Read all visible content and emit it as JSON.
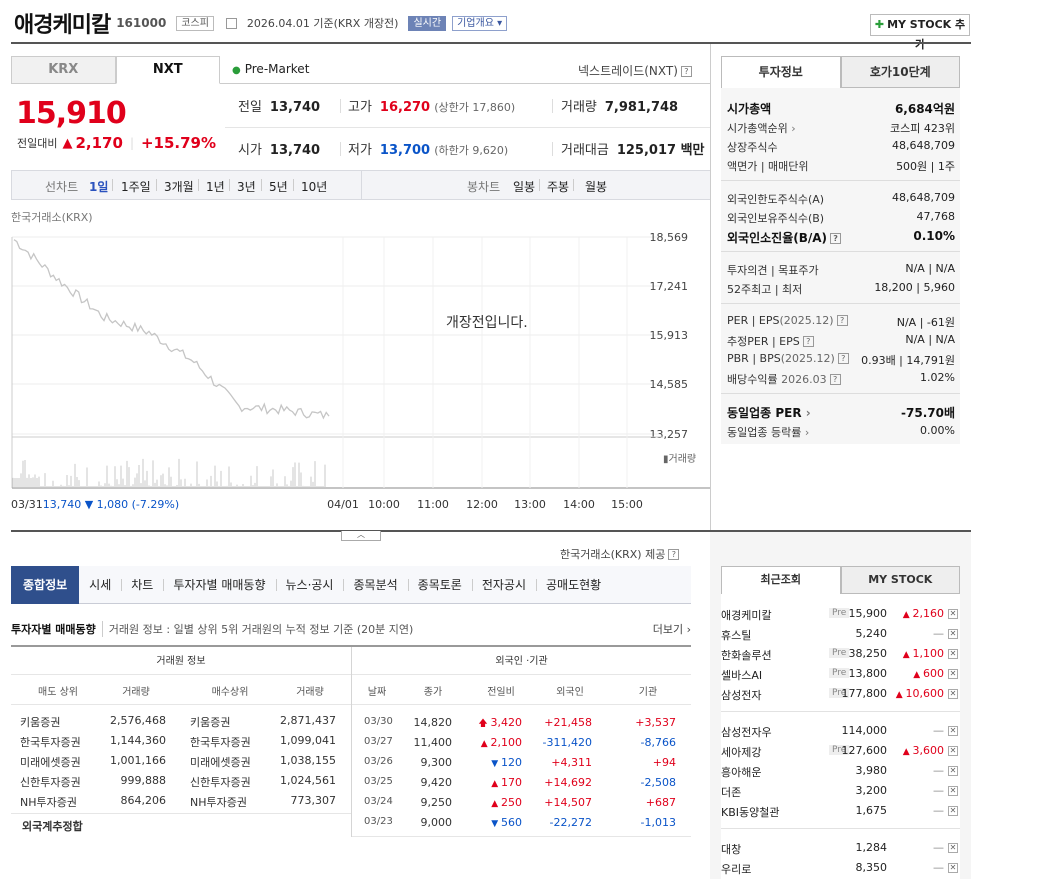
{
  "header": {
    "company_name": "애경케미칼",
    "code": "161000",
    "market_tag": "코스피",
    "date_text": "2026.04.01  기준(KRX 개장전)",
    "realtime_tag": "실시간",
    "company_overview": "기업개요",
    "mystock_button": "MY STOCK 추가"
  },
  "market_tabs": {
    "krx": "KRX",
    "nxt": "NXT"
  },
  "premarket_label": "Pre-Market",
  "nxt_link": "넥스트레이드(NXT)",
  "quote": {
    "price": "15,910",
    "change_label": "전일대비",
    "change_amount": "2,170",
    "change_percent": "+15.79%",
    "prev_close_label": "전일",
    "prev_close": "13,740",
    "high_label": "고가",
    "high": "16,270",
    "upper_limit": "(상한가 17,860)",
    "volume_label": "거래량",
    "volume": "7,981,748",
    "open_label": "시가",
    "open": "13,740",
    "low_label": "저가",
    "low": "13,700",
    "lower_limit": "(하한가 9,620)",
    "value_label": "거래대금",
    "value": "125,017 백만"
  },
  "period_bar": {
    "line_label": "선차트",
    "periods": [
      "1일",
      "1주일",
      "3개월",
      "1년",
      "3년",
      "5년",
      "10년"
    ],
    "candle_label": "봉차트",
    "candles": [
      "일봉",
      "주봉",
      "월봉"
    ]
  },
  "chart": {
    "source": "한국거래소(KRX)",
    "y_ticks": [
      "18,569",
      "17,241",
      "15,913",
      "14,585",
      "13,257"
    ],
    "volume_label": "거래량",
    "x_ticks": [
      "04/01",
      "10:00",
      "11:00",
      "12:00",
      "13:00",
      "14:00",
      "15:00"
    ],
    "prev_info_date": "03/31",
    "prev_info_price": "13,740",
    "prev_info_change": "1,080 (-7.29%)",
    "pre_open_message": "개장전입니다."
  },
  "chart_data": {
    "type": "line",
    "title": "",
    "x": [
      "03/31 09:00",
      "03/31 10:00",
      "03/31 11:00",
      "03/31 12:00",
      "03/31 13:00",
      "03/31 14:00",
      "03/31 15:00",
      "03/31 15:30"
    ],
    "series": [
      {
        "values": [
          18500,
          17400,
          16400,
          16000,
          15200,
          14000,
          13900,
          13740
        ]
      }
    ],
    "ylim": [
      13257,
      18569
    ],
    "xlabel": "",
    "ylabel": ""
  },
  "invest_tabs": {
    "info": "투자정보",
    "orderbook": "호가10단계"
  },
  "invest_info": {
    "market_cap_label": "시가총액",
    "market_cap": "6,684억원",
    "rank_label": "시가총액순위",
    "rank": "코스피  423위",
    "shares_label": "상장주식수",
    "shares": "48,648,709",
    "par_label": "액면가 | 매매단위",
    "par": "500원 | 1주",
    "foreign_limit_label": "외국인한도주식수(A)",
    "foreign_limit": "48,648,709",
    "foreign_hold_label": "외국인보유주식수(B)",
    "foreign_hold": "47,768",
    "foreign_ratio_label": "외국인소진율(B/A)",
    "foreign_ratio": "0.10%",
    "opinion_label": "투자의견 | 목표주가",
    "opinion": "N/A | N/A",
    "range52_label": "52주최고 | 최저",
    "range52": "18,200 | 5,960",
    "per_label": "PER | EPS",
    "per_sub": "(2025.12)",
    "per": "N/A | -61원",
    "est_label": "추정PER | EPS",
    "est": "N/A | N/A",
    "pbr_label": "PBR | BPS",
    "pbr_sub": "(2025.12)",
    "pbr": "0.93배 | 14,791원",
    "div_label": "배당수익률",
    "div_sub": "2026.03",
    "div": "1.02%",
    "sector_per_label": "동일업종 PER",
    "sector_per": "-75.70배",
    "sector_rate_label": "동일업종 등락률",
    "sector_rate": "0.00%"
  },
  "provider": "한국거래소(KRX) 제공",
  "main_tabs": [
    "종합정보",
    "시세",
    "차트",
    "투자자별 매매동향",
    "뉴스·공시",
    "종목분석",
    "종목토론",
    "전자공시",
    "공매도현황"
  ],
  "trade": {
    "title": "투자자별 매매동향",
    "desc": "거래원 정보 : 일별 상위 5위 거래원의 누적 정보 기준 (20분 지연)",
    "more": "더보기",
    "group_broker": "거래원 정보",
    "group_foreign": "외국인 ·기관",
    "broker_headers": [
      "매도 상위",
      "거래량",
      "매수상위",
      "거래량"
    ],
    "brokers": [
      [
        "키움증권",
        "2,576,468",
        "키움증권",
        "2,871,437"
      ],
      [
        "한국투자증권",
        "1,144,360",
        "한국투자증권",
        "1,099,041"
      ],
      [
        "미래에셋증권",
        "1,001,166",
        "미래에셋증권",
        "1,038,155"
      ],
      [
        "신한투자증권",
        "999,888",
        "신한투자증권",
        "1,024,561"
      ],
      [
        "NH투자증권",
        "864,206",
        "NH투자증권",
        "773,307"
      ]
    ],
    "foreign_total_label": "외국계추정합",
    "foreign_headers": [
      "날짜",
      "종가",
      "전일비",
      "외국인",
      "기관"
    ],
    "foreign_rows": [
      [
        "03/30",
        "14,820",
        "3,420",
        "+21,458",
        "+3,537"
      ],
      [
        "03/27",
        "11,400",
        "2,100",
        "-311,420",
        "-8,766"
      ],
      [
        "03/26",
        "9,300",
        "120",
        "+4,311",
        "+94"
      ],
      [
        "03/25",
        "9,420",
        "170",
        "+14,692",
        "-2,508"
      ],
      [
        "03/24",
        "9,250",
        "250",
        "+14,507",
        "+687"
      ],
      [
        "03/23",
        "9,000",
        "560",
        "-22,272",
        "-1,013"
      ]
    ]
  },
  "recent_tabs": {
    "recent": "최근조회",
    "mystock": "MY STOCK"
  },
  "recent": [
    {
      "name": "애경케미칼",
      "pre": "Pre",
      "price": "15,900",
      "change": "2,160",
      "dir": "up"
    },
    {
      "name": "휴스틸",
      "pre": "",
      "price": "5,240",
      "change": "",
      "dir": "flat"
    },
    {
      "name": "한화솔루션",
      "pre": "Pre",
      "price": "38,250",
      "change": "1,100",
      "dir": "up"
    },
    {
      "name": "셀바스AI",
      "pre": "Pre",
      "price": "13,800",
      "change": "600",
      "dir": "up"
    },
    {
      "name": "삼성전자",
      "pre": "Pre",
      "price": "177,800",
      "change": "10,600",
      "dir": "up"
    },
    {
      "name": "삼성전자우",
      "pre": "",
      "price": "114,000",
      "change": "",
      "dir": "flat"
    },
    {
      "name": "세아제강",
      "pre": "Pre",
      "price": "127,600",
      "change": "3,600",
      "dir": "up"
    },
    {
      "name": "흥아해운",
      "pre": "",
      "price": "3,980",
      "change": "",
      "dir": "flat"
    },
    {
      "name": "더존",
      "pre": "",
      "price": "3,200",
      "change": "",
      "dir": "flat"
    },
    {
      "name": "KBI동양철관",
      "pre": "",
      "price": "1,675",
      "change": "",
      "dir": "flat"
    },
    {
      "name": "대창",
      "pre": "",
      "price": "1,284",
      "change": "",
      "dir": "flat"
    },
    {
      "name": "우리로",
      "pre": "",
      "price": "8,350",
      "change": "",
      "dir": "flat"
    }
  ],
  "colors": {
    "up": "#e0001b",
    "down": "#0a54c8",
    "tab_active": "#2f4f8c"
  }
}
